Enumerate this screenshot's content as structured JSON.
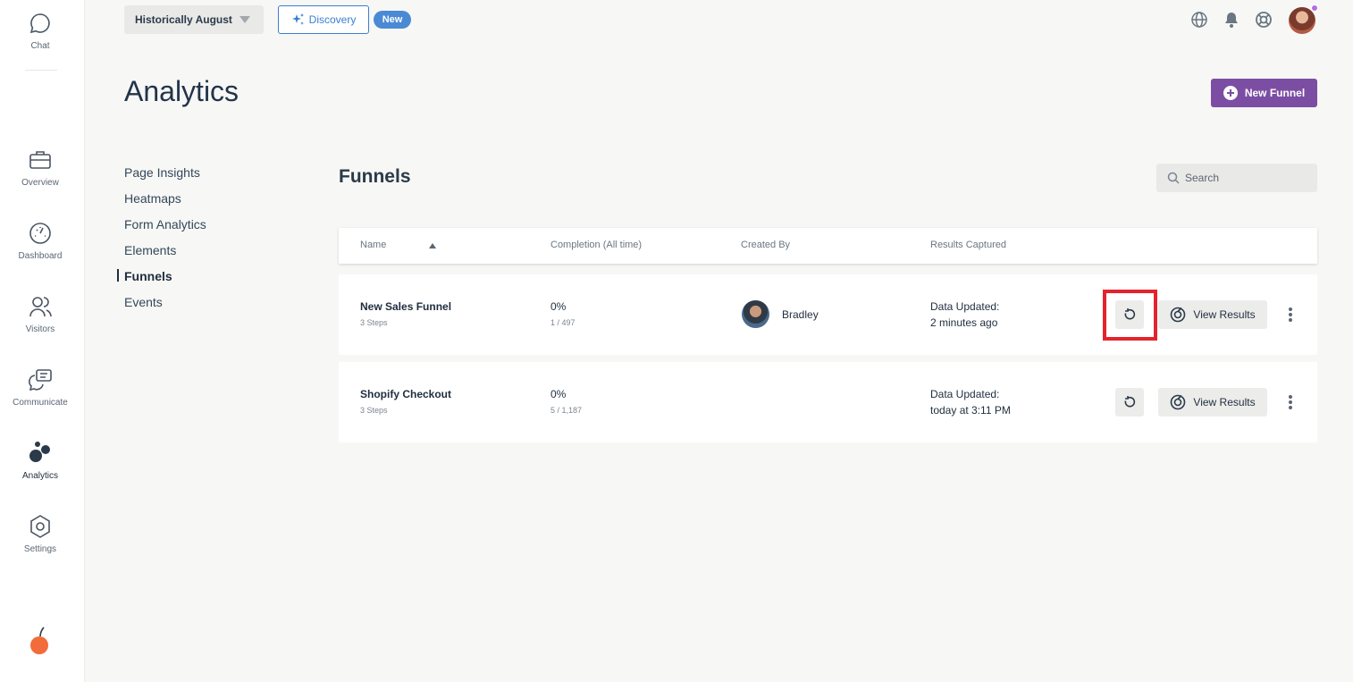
{
  "rail": {
    "chat": "Chat",
    "items": [
      {
        "label": "Overview",
        "icon": "briefcase-icon"
      },
      {
        "label": "Dashboard",
        "icon": "gauge-icon"
      },
      {
        "label": "Visitors",
        "icon": "users-icon"
      },
      {
        "label": "Communicate",
        "icon": "chat-bubbles-icon"
      },
      {
        "label": "Analytics",
        "icon": "analytics-dots-icon"
      },
      {
        "label": "Settings",
        "icon": "hexagon-gear-icon"
      }
    ],
    "active": "Analytics",
    "logo": "orange-fruit-logo"
  },
  "topbar": {
    "date_range": "Historically August",
    "discovery_label": "Discovery",
    "new_badge": "New",
    "icons": [
      "globe-icon",
      "bell-icon",
      "lifebuoy-icon"
    ],
    "notification_dot_color": "#b36de0"
  },
  "page": {
    "title": "Analytics",
    "new_funnel_label": "New Funnel",
    "accent_color": "#7b4ea3"
  },
  "subnav": {
    "items": [
      "Page Insights",
      "Heatmaps",
      "Form Analytics",
      "Elements",
      "Funnels",
      "Events"
    ],
    "active": "Funnels"
  },
  "funnels": {
    "title": "Funnels",
    "search_placeholder": "Search",
    "columns": [
      "Name",
      "Completion (All time)",
      "Created By",
      "Results Captured"
    ],
    "rows": [
      {
        "name": "New Sales Funnel",
        "steps": "3 Steps",
        "completion": "0%",
        "ratio": "1 / 497",
        "created_by": "Bradley",
        "updated_label": "Data Updated:",
        "updated_value": "2 minutes ago",
        "view_label": "View Results",
        "refresh_highlighted": true
      },
      {
        "name": "Shopify Checkout",
        "steps": "3 Steps",
        "completion": "0%",
        "ratio": "5 / 1,187",
        "created_by": "",
        "updated_label": "Data Updated:",
        "updated_value": "today at 3:11 PM",
        "view_label": "View Results",
        "refresh_highlighted": false
      }
    ]
  }
}
